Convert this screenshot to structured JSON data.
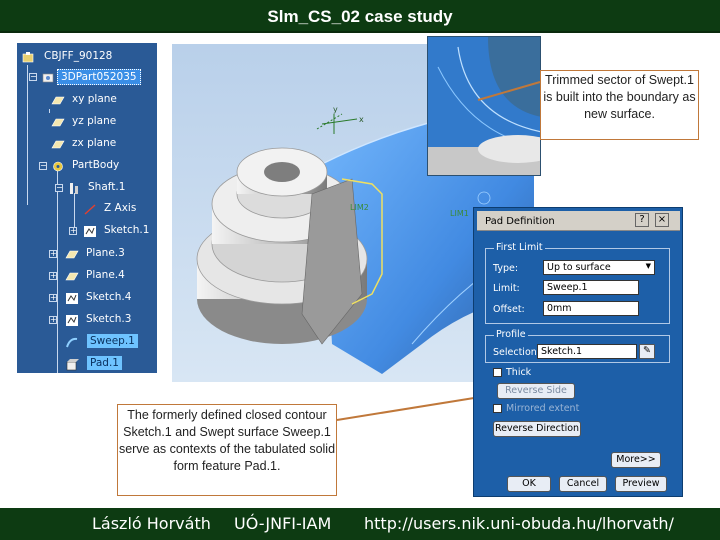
{
  "header": {
    "title": "Slm_CS_02 case study"
  },
  "footer": {
    "author": "László Horváth",
    "institute": "UÓ-JNFI-IAM",
    "url": "http://users.nik.uni-obuda.hu/lhorvath/"
  },
  "tree": {
    "root": "CBJFF_90128",
    "part": "3DPart052035",
    "items": [
      {
        "label": "xy plane"
      },
      {
        "label": "yz plane"
      },
      {
        "label": "zx plane"
      },
      {
        "label": "PartBody"
      },
      {
        "label": "Shaft.1"
      },
      {
        "label": "Z Axis"
      },
      {
        "label": "Sketch.1"
      },
      {
        "label": "Plane.3"
      },
      {
        "label": "Plane.4"
      },
      {
        "label": "Sketch.4"
      },
      {
        "label": "Sketch.3"
      },
      {
        "label": "Sweep.1"
      },
      {
        "label": "Pad.1"
      }
    ]
  },
  "viewport": {
    "axis_x": "x",
    "axis_y": "y",
    "label_lim2": "LIM2",
    "label_lim1": "LIM1"
  },
  "callouts": {
    "top": "Trimmed sector of Swept.1 is built into the boundary as new surface.",
    "bottom": "The formerly defined closed contour Sketch.1 and Swept surface Sweep.1 serve as contexts of the tabulated solid form feature Pad.1."
  },
  "dialog": {
    "title": "Pad Definition",
    "help": "?",
    "close": "×",
    "first_limit": {
      "group": "First Limit",
      "type_label": "Type:",
      "type_value": "Up to surface",
      "limit_label": "Limit:",
      "limit_value": "Sweep.1",
      "offset_label": "Offset:",
      "offset_value": "0mm"
    },
    "profile": {
      "group": "Profile",
      "selection_label": "Selection:",
      "selection_value": "Sketch.1"
    },
    "thick_label": "Thick",
    "reverse_side": "Reverse Side",
    "mirrored_extent": "Mirrored extent",
    "reverse_direction": "Reverse Direction",
    "more": "More>>",
    "ok": "OK",
    "cancel": "Cancel",
    "preview": "Preview"
  },
  "colors": {
    "title_bg": "#0d3b12",
    "tree_bg": "#2a5a96",
    "dialog_bg": "#1d5fa8",
    "callout_border": "#c0783a",
    "surface_blue": "#2f7fe0"
  }
}
